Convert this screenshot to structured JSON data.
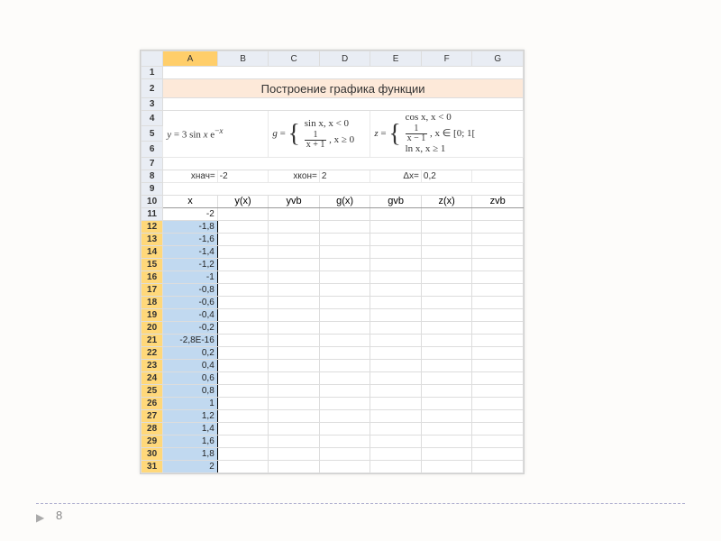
{
  "page_number": "8",
  "columns": [
    "A",
    "B",
    "C",
    "D",
    "E",
    "F",
    "G"
  ],
  "title": "Построение графика функции",
  "formulas": {
    "y": "y = 3 sin x e<sup>−x</sup>",
    "g_top": "sin x, x < 0",
    "g_bot_num": "1",
    "g_bot_den": "x + 1",
    "g_bot_cond": ", x ≥ 0",
    "z_top": "cos x, x < 0",
    "z_mid_num": "1",
    "z_mid_den": "x − 1",
    "z_mid_cond": ", x ∈ [0; 1[",
    "z_bot": "ln x, x ≥ 1"
  },
  "params": {
    "xstart_lbl": "хнач=",
    "xstart_val": "-2",
    "xend_lbl": "хкон=",
    "xend_val": "2",
    "dx_lbl": "Δx=",
    "dx_val": "0,2"
  },
  "headers": [
    "x",
    "y(x)",
    "yvb",
    "g(x)",
    "gvb",
    "z(x)",
    "zvb"
  ],
  "rows": [
    {
      "n": 11,
      "v": "-2"
    },
    {
      "n": 12,
      "v": "-1,8"
    },
    {
      "n": 13,
      "v": "-1,6"
    },
    {
      "n": 14,
      "v": "-1,4"
    },
    {
      "n": 15,
      "v": "-1,2"
    },
    {
      "n": 16,
      "v": "-1"
    },
    {
      "n": 17,
      "v": "-0,8"
    },
    {
      "n": 18,
      "v": "-0,6"
    },
    {
      "n": 19,
      "v": "-0,4"
    },
    {
      "n": 20,
      "v": "-0,2"
    },
    {
      "n": 21,
      "v": "-2,8E-16"
    },
    {
      "n": 22,
      "v": "0,2"
    },
    {
      "n": 23,
      "v": "0,4"
    },
    {
      "n": 24,
      "v": "0,6"
    },
    {
      "n": 25,
      "v": "0,8"
    },
    {
      "n": 26,
      "v": "1"
    },
    {
      "n": 27,
      "v": "1,2"
    },
    {
      "n": 28,
      "v": "1,4"
    },
    {
      "n": 29,
      "v": "1,6"
    },
    {
      "n": 30,
      "v": "1,8"
    },
    {
      "n": 31,
      "v": "2"
    }
  ]
}
